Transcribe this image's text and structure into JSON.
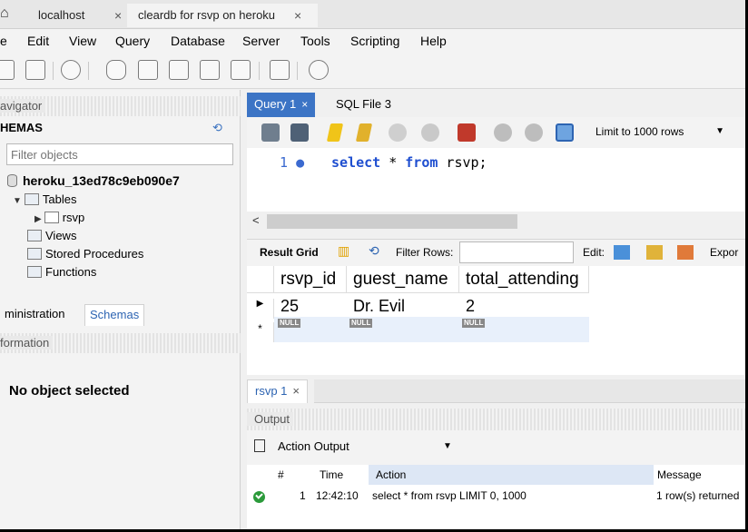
{
  "browser_tabs": [
    {
      "label": "localhost",
      "close": "×"
    },
    {
      "label": "cleardb for rsvp on heroku",
      "close": "×"
    }
  ],
  "menu": [
    "e",
    "Edit",
    "View",
    "Query",
    "Database",
    "Server",
    "Tools",
    "Scripting",
    "Help"
  ],
  "toolbar_icons": [
    "sql-new-icon",
    "sql-open-icon",
    "info-icon",
    "create-schema-icon",
    "create-table-icon",
    "create-view-icon",
    "create-procedure-icon",
    "create-function-icon",
    "search-table-icon",
    "reconnect-icon"
  ],
  "navigator": {
    "header": "avigator",
    "schemas_title": "HEMAS",
    "filter_placeholder": "Filter objects",
    "tree": {
      "schema": "heroku_13ed78c9eb090e7",
      "tables": "Tables",
      "table_item": "rsvp",
      "views": "Views",
      "procedures": "Stored Procedures",
      "functions": "Functions"
    },
    "subtabs": [
      "ministration",
      "Schemas"
    ],
    "info_header": "formation",
    "no_object": "No object selected"
  },
  "editor": {
    "tabs": [
      {
        "label": "Query 1",
        "close": "×"
      },
      {
        "label": "SQL File 3"
      }
    ],
    "limit_select": "Limit to 1000 rows",
    "line_number": "1",
    "line_marker": "●",
    "code_select": "select",
    "code_rest": " * ",
    "code_from": "from",
    "code_table": " rsvp;"
  },
  "result_toolbar": {
    "result_grid": "Result Grid",
    "filter_rows": "Filter Rows:",
    "edit": "Edit:",
    "export": "Expor"
  },
  "grid": {
    "columns": [
      "rsvp_id",
      "guest_name",
      "total_attending"
    ],
    "rows": [
      [
        "25",
        "Dr. Evil",
        "2"
      ]
    ],
    "null_label": "NULL",
    "row_marker": "▶",
    "new_marker": "*"
  },
  "result_tab": {
    "label": "rsvp 1",
    "close": "×"
  },
  "output": {
    "header": "Output",
    "select_value": "Action Output",
    "columns": [
      "#",
      "Time",
      "Action",
      "Message"
    ],
    "rows": [
      {
        "num": "1",
        "time": "12:42:10",
        "action": "select * from rsvp LIMIT 0, 1000",
        "message": "1 row(s) returned"
      }
    ]
  },
  "colors": {
    "accent": "#3c74c5",
    "keyword": "#1f4fd0",
    "success": "#2b9a3a"
  }
}
